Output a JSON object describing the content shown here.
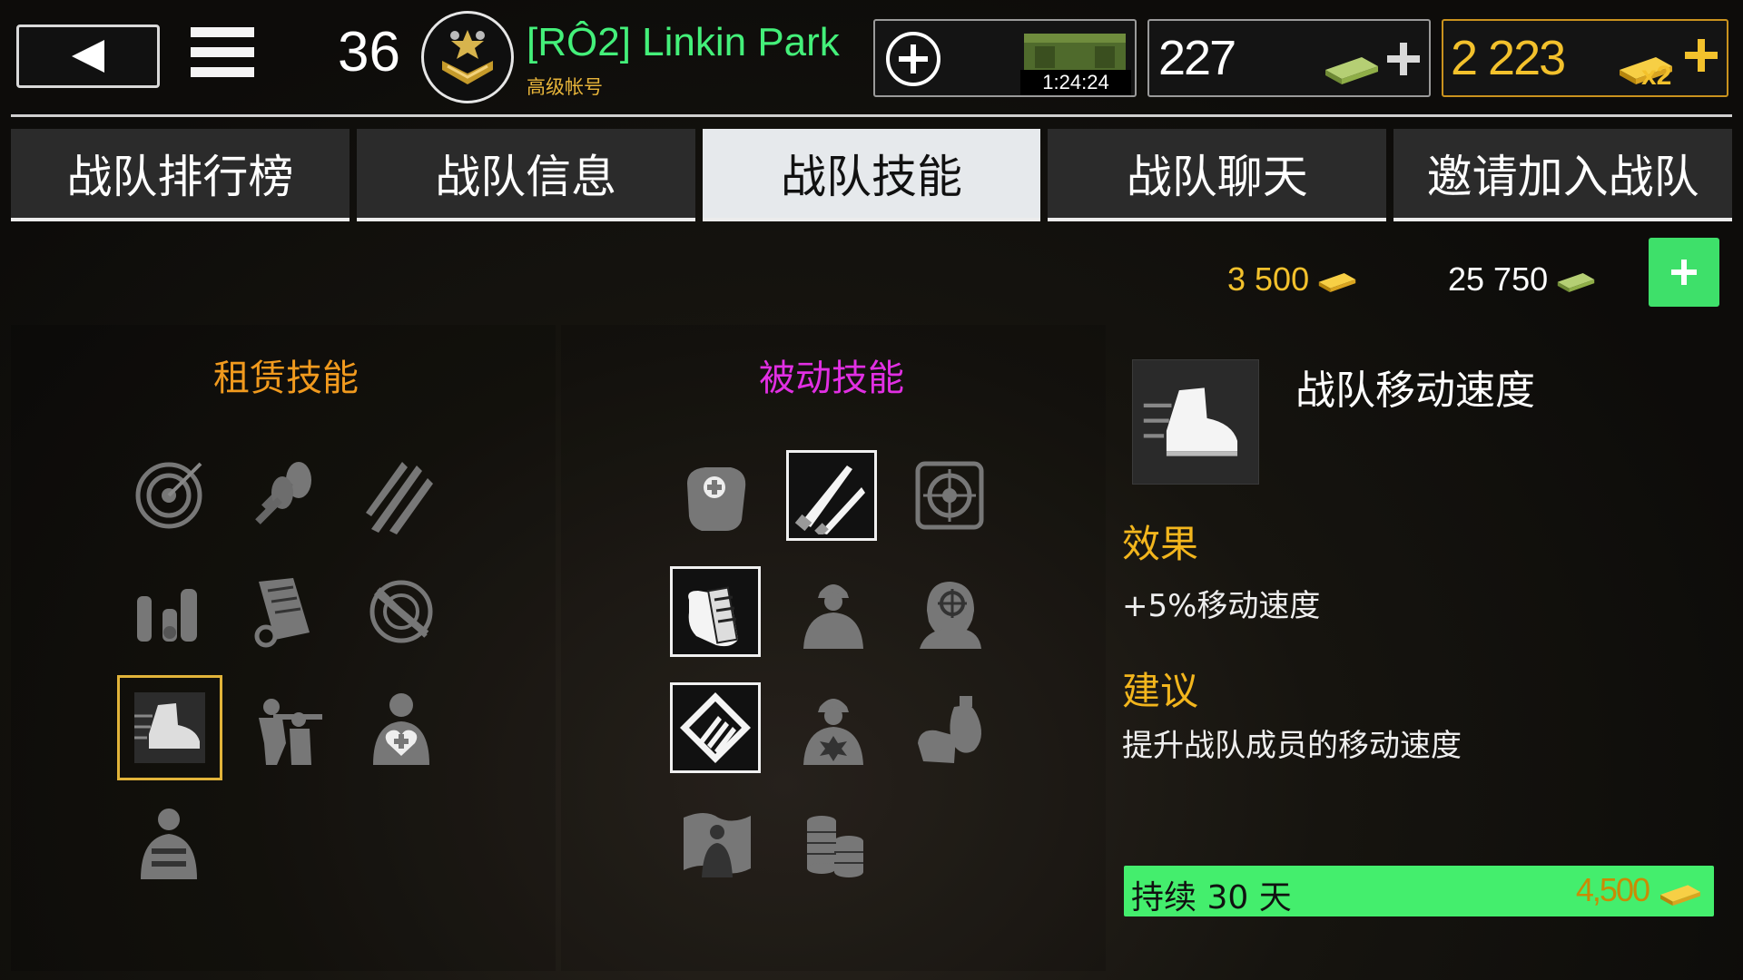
{
  "header": {
    "level": "36",
    "player_name": "[RÔ2] Linkin Park",
    "account_type": "高级帐号",
    "crate_timer": "1:24:24",
    "cash": "227",
    "gold": "2 223",
    "gold_multiplier": "x2"
  },
  "tabs": [
    {
      "label": "战队排行榜",
      "active": false
    },
    {
      "label": "战队信息",
      "active": false
    },
    {
      "label": "战队技能",
      "active": true
    },
    {
      "label": "战队聊天",
      "active": false
    },
    {
      "label": "邀请加入战队",
      "active": false
    }
  ],
  "clan_funds": {
    "gold": "3 500",
    "cash": "25 750"
  },
  "sections": {
    "rent_title": "租赁技能",
    "passive_title": "被动技能"
  },
  "rent_skills": [
    {
      "icon": "target-icon"
    },
    {
      "icon": "grenades-icon"
    },
    {
      "icon": "bullets-icon"
    },
    {
      "icon": "ammo-icon"
    },
    {
      "icon": "magazine-icon"
    },
    {
      "icon": "no-rifle-target-icon"
    },
    {
      "icon": "boot-icon",
      "selected": true
    },
    {
      "icon": "soldiers-aiming-icon"
    },
    {
      "icon": "medic-heart-icon"
    },
    {
      "icon": "armored-soldier-icon"
    }
  ],
  "passive_skills": [
    {
      "icon": "medkit-bag-icon"
    },
    {
      "icon": "knives-icon",
      "owned": true
    },
    {
      "icon": "scope-icon"
    },
    {
      "icon": "hand-magazine-icon",
      "owned": true
    },
    {
      "icon": "soldier-helmet-icon"
    },
    {
      "icon": "soldier-crosshair-icon"
    },
    {
      "icon": "ammo-diamond-icon",
      "owned": true
    },
    {
      "icon": "soldier-explosion-icon"
    },
    {
      "icon": "hand-moneybag-icon"
    },
    {
      "icon": "flag-soldier-icon"
    },
    {
      "icon": "coins-stack-icon"
    }
  ],
  "detail": {
    "title": "战队移动速度",
    "effect_label": "效果",
    "effect_text": "+5%移动速度",
    "advice_label": "建议",
    "advice_text": "提升战队成员的移动速度",
    "duration": "持续 30 天",
    "price": "4,500"
  },
  "colors": {
    "accent_green": "#44ee6d",
    "gold": "#f3c12c",
    "rent_title": "#f19a1e",
    "passive_title": "#e12fe3"
  }
}
